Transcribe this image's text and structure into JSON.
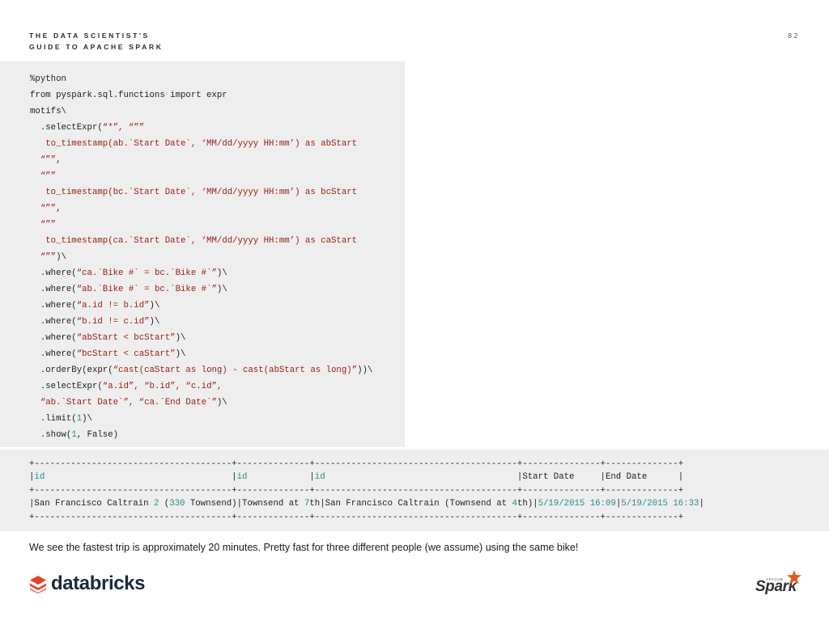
{
  "header": {
    "title_line1": "THE DATA SCIENTIST'S",
    "title_line2": "GUIDE TO APACHE SPARK",
    "page_number": "82"
  },
  "code_lines": [
    [
      {
        "t": "%python"
      }
    ],
    [
      {
        "t": "from pyspark.sql.functions import expr"
      }
    ],
    [
      {
        "t": "motifs\\"
      }
    ],
    [
      {
        "t": "  .selectExpr("
      },
      {
        "t": "“*”, “””",
        "c": "s"
      }
    ],
    [
      {
        "t": "   to_timestamp(ab.`Start Date`, ‘MM/dd/yyyy HH:mm’) as abStart",
        "c": "s"
      }
    ],
    [
      {
        "t": "  “””",
        "c": "s"
      },
      {
        "t": ","
      }
    ],
    [
      {
        "t": "  “””",
        "c": "s"
      }
    ],
    [
      {
        "t": "   to_timestamp(bc.`Start Date`, ‘MM/dd/yyyy HH:mm’) as bcStart",
        "c": "s"
      }
    ],
    [
      {
        "t": "  “””",
        "c": "s"
      },
      {
        "t": ","
      }
    ],
    [
      {
        "t": "  “””",
        "c": "s"
      }
    ],
    [
      {
        "t": "   to_timestamp(ca.`Start Date`, ‘MM/dd/yyyy HH:mm’) as caStart",
        "c": "s"
      }
    ],
    [
      {
        "t": "  “””",
        "c": "s"
      },
      {
        "t": ")\\"
      }
    ],
    [
      {
        "t": "  .where("
      },
      {
        "t": "“ca.`Bike #` = bc.`Bike #`”",
        "c": "s"
      },
      {
        "t": ")\\"
      }
    ],
    [
      {
        "t": "  .where("
      },
      {
        "t": "“ab.`Bike #` = bc.`Bike #`”",
        "c": "s"
      },
      {
        "t": ")\\"
      }
    ],
    [
      {
        "t": "  .where("
      },
      {
        "t": "“a.id != b.id”",
        "c": "s"
      },
      {
        "t": ")\\"
      }
    ],
    [
      {
        "t": "  .where("
      },
      {
        "t": "“b.id != c.id”",
        "c": "s"
      },
      {
        "t": ")\\"
      }
    ],
    [
      {
        "t": "  .where("
      },
      {
        "t": "“abStart < bcStart”",
        "c": "s"
      },
      {
        "t": ")\\"
      }
    ],
    [
      {
        "t": "  .where("
      },
      {
        "t": "“bcStart < caStart”",
        "c": "s"
      },
      {
        "t": ")\\"
      }
    ],
    [
      {
        "t": "  .orderBy(expr("
      },
      {
        "t": "“cast(caStart as long) - cast(abStart as long)”",
        "c": "s"
      },
      {
        "t": "))\\"
      }
    ],
    [
      {
        "t": "  .selectExpr("
      },
      {
        "t": "“a.id”, “b.id”, “c.id”,",
        "c": "s"
      }
    ],
    [
      {
        "t": "  “ab.`Start Date`”, “ca.`End Date`”",
        "c": "s"
      },
      {
        "t": ")\\"
      }
    ],
    [
      {
        "t": "  .limit("
      },
      {
        "t": "1",
        "c": "n"
      },
      {
        "t": ")\\"
      }
    ],
    [
      {
        "t": "  .show("
      },
      {
        "t": "1",
        "c": "n"
      },
      {
        "t": ", False)"
      }
    ]
  ],
  "output_lines": [
    [
      {
        "t": "+--------------------------------------+--------------+---------------------------------------+---------------+--------------+"
      }
    ],
    [
      {
        "t": "|"
      },
      {
        "t": "id",
        "c": "t"
      },
      {
        "t": "                                    |"
      },
      {
        "t": "id",
        "c": "t"
      },
      {
        "t": "            |"
      },
      {
        "t": "id",
        "c": "t"
      },
      {
        "t": "                                     |Start Date     |End Date      |"
      }
    ],
    [
      {
        "t": "+--------------------------------------+--------------+---------------------------------------+---------------+--------------+"
      }
    ],
    [
      {
        "t": "|San Francisco Caltrain "
      },
      {
        "t": "2",
        "c": "t"
      },
      {
        "t": " ("
      },
      {
        "t": "330",
        "c": "t"
      },
      {
        "t": " Townsend)|Townsend at "
      },
      {
        "t": "7",
        "c": "t"
      },
      {
        "t": "th|San Francisco Caltrain (Townsend at "
      },
      {
        "t": "4",
        "c": "t"
      },
      {
        "t": "th)|"
      },
      {
        "t": "5/19/2015 16:09",
        "c": "t"
      },
      {
        "t": "|"
      },
      {
        "t": "5/19/2015 16:33",
        "c": "t"
      },
      {
        "t": "|"
      }
    ],
    [
      {
        "t": "+--------------------------------------+--------------+---------------------------------------+---------------+--------------+"
      }
    ]
  ],
  "caption": "We see the fastest trip is approximately 20 minutes. Pretty fast for three different people (we assume) using the same bike!",
  "footer": {
    "databricks_text": "databricks",
    "spark_apache_text": "APACHE",
    "spark_text": "Spark"
  },
  "colors": {
    "code_string": "#9b1b13",
    "code_number": "#2a8a8a",
    "panel_bg": "#eeeeee",
    "databricks_red": "#e8412c",
    "spark_orange": "#e25a1c"
  }
}
